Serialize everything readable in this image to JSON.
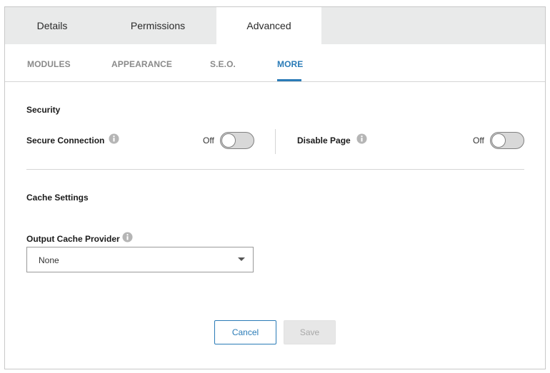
{
  "top_tabs": [
    {
      "label": "Details"
    },
    {
      "label": "Permissions"
    },
    {
      "label": "Advanced",
      "active": true
    }
  ],
  "sub_tabs": [
    {
      "label": "MODULES"
    },
    {
      "label": "APPEARANCE"
    },
    {
      "label": "S.E.O."
    },
    {
      "label": "MORE",
      "active": true
    }
  ],
  "security": {
    "title": "Security",
    "secure_connection": {
      "label": "Secure Connection",
      "state_label": "Off",
      "on": false
    },
    "disable_page": {
      "label": "Disable Page",
      "state_label": "Off",
      "on": false
    }
  },
  "cache": {
    "title": "Cache Settings",
    "provider_label": "Output Cache Provider",
    "provider_value": "None"
  },
  "actions": {
    "cancel_label": "Cancel",
    "save_label": "Save"
  },
  "colors": {
    "accent": "#2a7bb7",
    "tab_bar_bg": "#e9eaea",
    "disabled_button_bg": "#e7e7e7"
  },
  "icons": [
    "info-icon",
    "chevron-down-icon"
  ]
}
